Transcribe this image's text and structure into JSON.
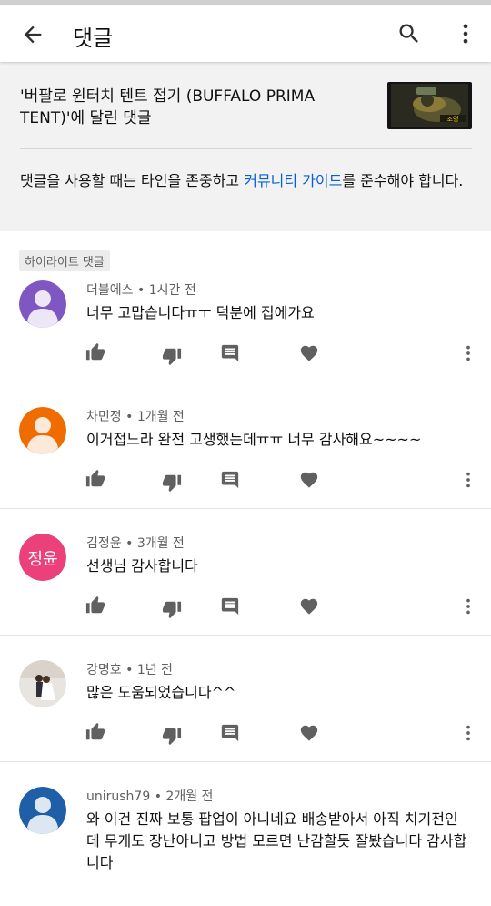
{
  "app_bar": {
    "title": "댓글",
    "back_icon": "arrow-back-icon",
    "search_icon": "search-icon",
    "more_icon": "more-vert-icon"
  },
  "video": {
    "title": "'버팔로 원터치 텐트 접기 (BUFFALO PRIMA TENT)'에 달린 댓글",
    "thumbnail_caption": "조영"
  },
  "guideline": {
    "before": "댓글을 사용할 때는 타인을 존중하고 ",
    "link": "커뮤니티 가이드",
    "after": "를 준수해야 합니다."
  },
  "highlight_label": "하이라이트 댓글",
  "colors": {
    "link": "#065fd4",
    "icon": "#606060",
    "panel_bg": "#f2f2f2"
  },
  "comments": [
    {
      "author": "더블에스",
      "time": "1시간 전",
      "text": "너무 고맙습니다ㅠㅜ 덕분에 집에가요",
      "avatar_type": "default-person",
      "avatar_color": "#7e57c2"
    },
    {
      "author": "차민정",
      "time": "1개월 전",
      "text": "이거접느라 완전 고생했는데ㅠㅠ 너무 감사해요~~~~",
      "avatar_type": "default-person",
      "avatar_color": "#ef6c00"
    },
    {
      "author": "김정윤",
      "time": "3개월 전",
      "text": "선생님 감사합니다",
      "avatar_type": "initials",
      "avatar_text": "정윤",
      "avatar_color": "#ec407a"
    },
    {
      "author": "강명호",
      "time": "1년 전",
      "text": "많은 도움되었습니다^^",
      "avatar_type": "photo"
    },
    {
      "author": "unirush79",
      "time": "2개월 전",
      "text": "와 이건 진짜 보통 팝업이 아니네요 배송받아서 아직 치기전인데 무게도 장난아니고 방법 모르면 난감할듯 잘봤습니다 감사합니다",
      "avatar_type": "default-person",
      "avatar_color": "#1e5fa8"
    }
  ],
  "comment_actions": {
    "like_icon": "thumb-up-icon",
    "dislike_icon": "thumb-down-icon",
    "reply_icon": "reply-comment-icon",
    "heart_icon": "heart-icon",
    "more_icon": "more-vert-icon"
  },
  "comment_meta_separator": " • "
}
